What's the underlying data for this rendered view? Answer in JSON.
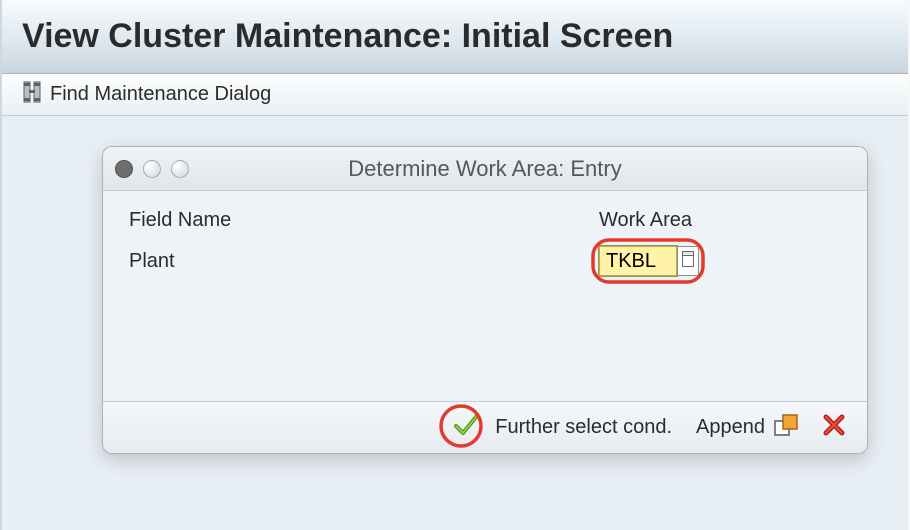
{
  "main": {
    "title": "View Cluster Maintenance: Initial Screen",
    "toolbar": {
      "find_dialog_label": "Find Maintenance Dialog"
    }
  },
  "dialog": {
    "title": "Determine Work Area: Entry",
    "headers": {
      "field_name": "Field Name",
      "work_area": "Work Area"
    },
    "rows": [
      {
        "label": "Plant",
        "value": "TKBL"
      }
    ],
    "footer": {
      "further_label": "Further select cond.",
      "append_label": "Append"
    }
  },
  "icons": {
    "find": "find-icon",
    "check": "checkmark-icon",
    "append": "overlap-squares-icon",
    "cancel": "cancel-x-icon",
    "f4": "page-icon"
  },
  "colors": {
    "highlight": "#e23b2e",
    "check_green": "#6aa821",
    "cancel_red": "#c9302c",
    "append_orange": "#e58a1f",
    "input_bg": "#fff3a8"
  }
}
